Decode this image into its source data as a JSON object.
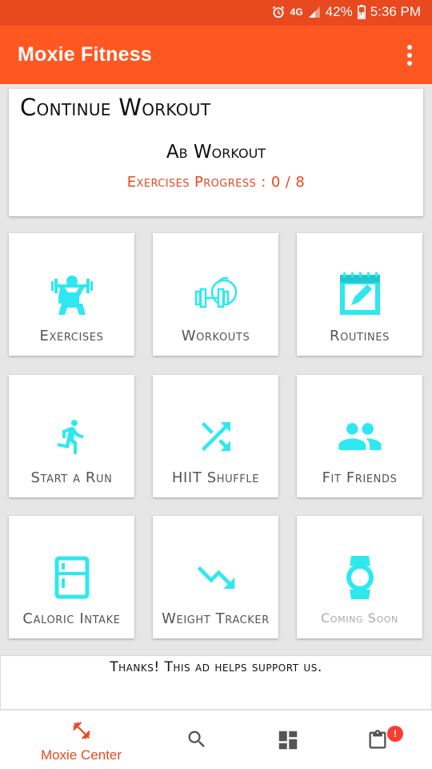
{
  "status_bar": {
    "network": "4G",
    "battery": "42%",
    "time": "5:36 PM"
  },
  "app_bar": {
    "title": "Moxie Fitness"
  },
  "continue_workout": {
    "title": "Continue Workout",
    "workout_name": "Ab Workout",
    "progress_text": "Exercises Progress : 0 / 8"
  },
  "tiles": [
    {
      "label": "Exercises",
      "icon": "weightlifter-icon"
    },
    {
      "label": "Workouts",
      "icon": "dumbbell-apple-icon"
    },
    {
      "label": "Routines",
      "icon": "calendar-edit-icon"
    },
    {
      "label": "Start a Run",
      "icon": "running-person-icon"
    },
    {
      "label": "HIIT Shuffle",
      "icon": "shuffle-icon"
    },
    {
      "label": "Fit Friends",
      "icon": "people-icon"
    },
    {
      "label": "Caloric Intake",
      "icon": "fridge-icon"
    },
    {
      "label": "Weight Tracker",
      "icon": "trending-down-icon"
    },
    {
      "label": "Coming Soon",
      "icon": "smartwatch-icon"
    }
  ],
  "ad": {
    "text": "Thanks! This ad helps support us."
  },
  "bottom_nav": {
    "items": [
      {
        "label": "Moxie Center",
        "icon": "dumbbell-icon"
      },
      {
        "label": "",
        "icon": "search-icon"
      },
      {
        "label": "",
        "icon": "dashboard-icon"
      },
      {
        "label": "",
        "icon": "clipboard-icon"
      }
    ],
    "badge": "!"
  },
  "colors": {
    "primary": "#ff5722",
    "status_bar": "#e8491f",
    "accent_icon": "#2ee8f0",
    "badge": "#ff3b30"
  }
}
